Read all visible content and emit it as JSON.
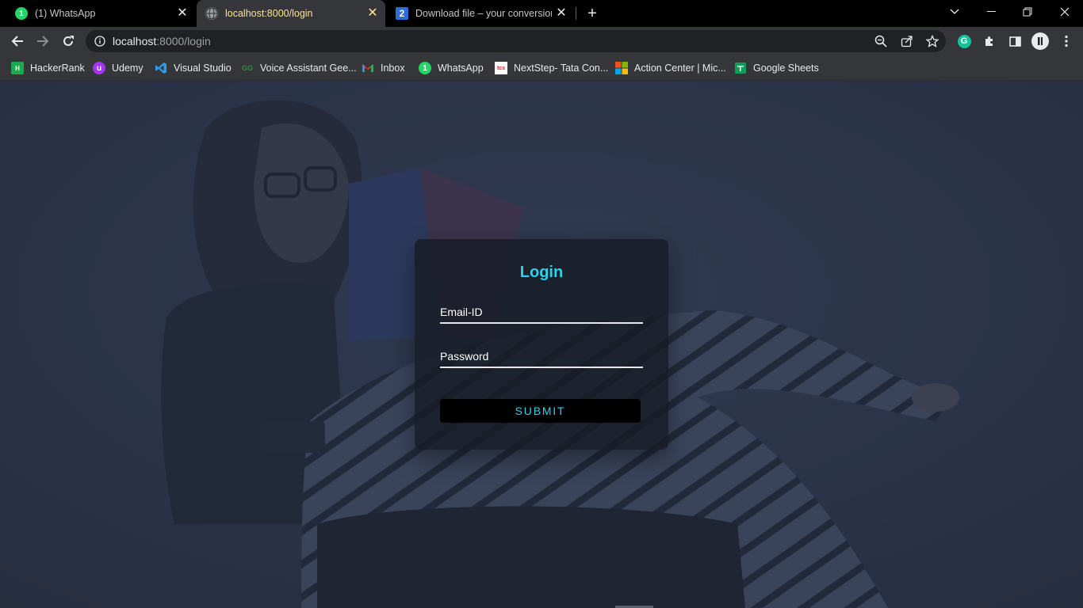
{
  "tabs": [
    {
      "title": "(1) WhatsApp",
      "active": false,
      "icon": "whatsapp-icon"
    },
    {
      "title": "localhost:8000/login",
      "active": true,
      "icon": "globe-icon"
    },
    {
      "title": "Download file – your conversion",
      "active": false,
      "icon": "number-2-icon"
    }
  ],
  "toolbar": {
    "url_host": "localhost",
    "url_rest": ":8000/login"
  },
  "bookmarks": [
    {
      "label": "HackerRank",
      "icon": "hackerrank-icon"
    },
    {
      "label": "Udemy",
      "icon": "udemy-icon"
    },
    {
      "label": "Visual Studio",
      "icon": "vscode-icon"
    },
    {
      "label": "Voice Assistant Gee...",
      "icon": "geeks-icon"
    },
    {
      "label": "Inbox",
      "icon": "gmail-icon"
    },
    {
      "label": "WhatsApp",
      "icon": "whatsapp-icon"
    },
    {
      "label": "NextStep- Tata Con...",
      "icon": "tcs-icon"
    },
    {
      "label": "Action Center | Mic...",
      "icon": "microsoft-icon"
    },
    {
      "label": "Google Sheets",
      "icon": "sheets-icon"
    }
  ],
  "login": {
    "title": "Login",
    "email_label": "Email-ID",
    "password_label": "Password",
    "submit_label": "SUBMIT"
  },
  "colors": {
    "accent": "#2ad3ea",
    "active_tab_text": "#fde293",
    "page_overlay": "#2b3446"
  }
}
